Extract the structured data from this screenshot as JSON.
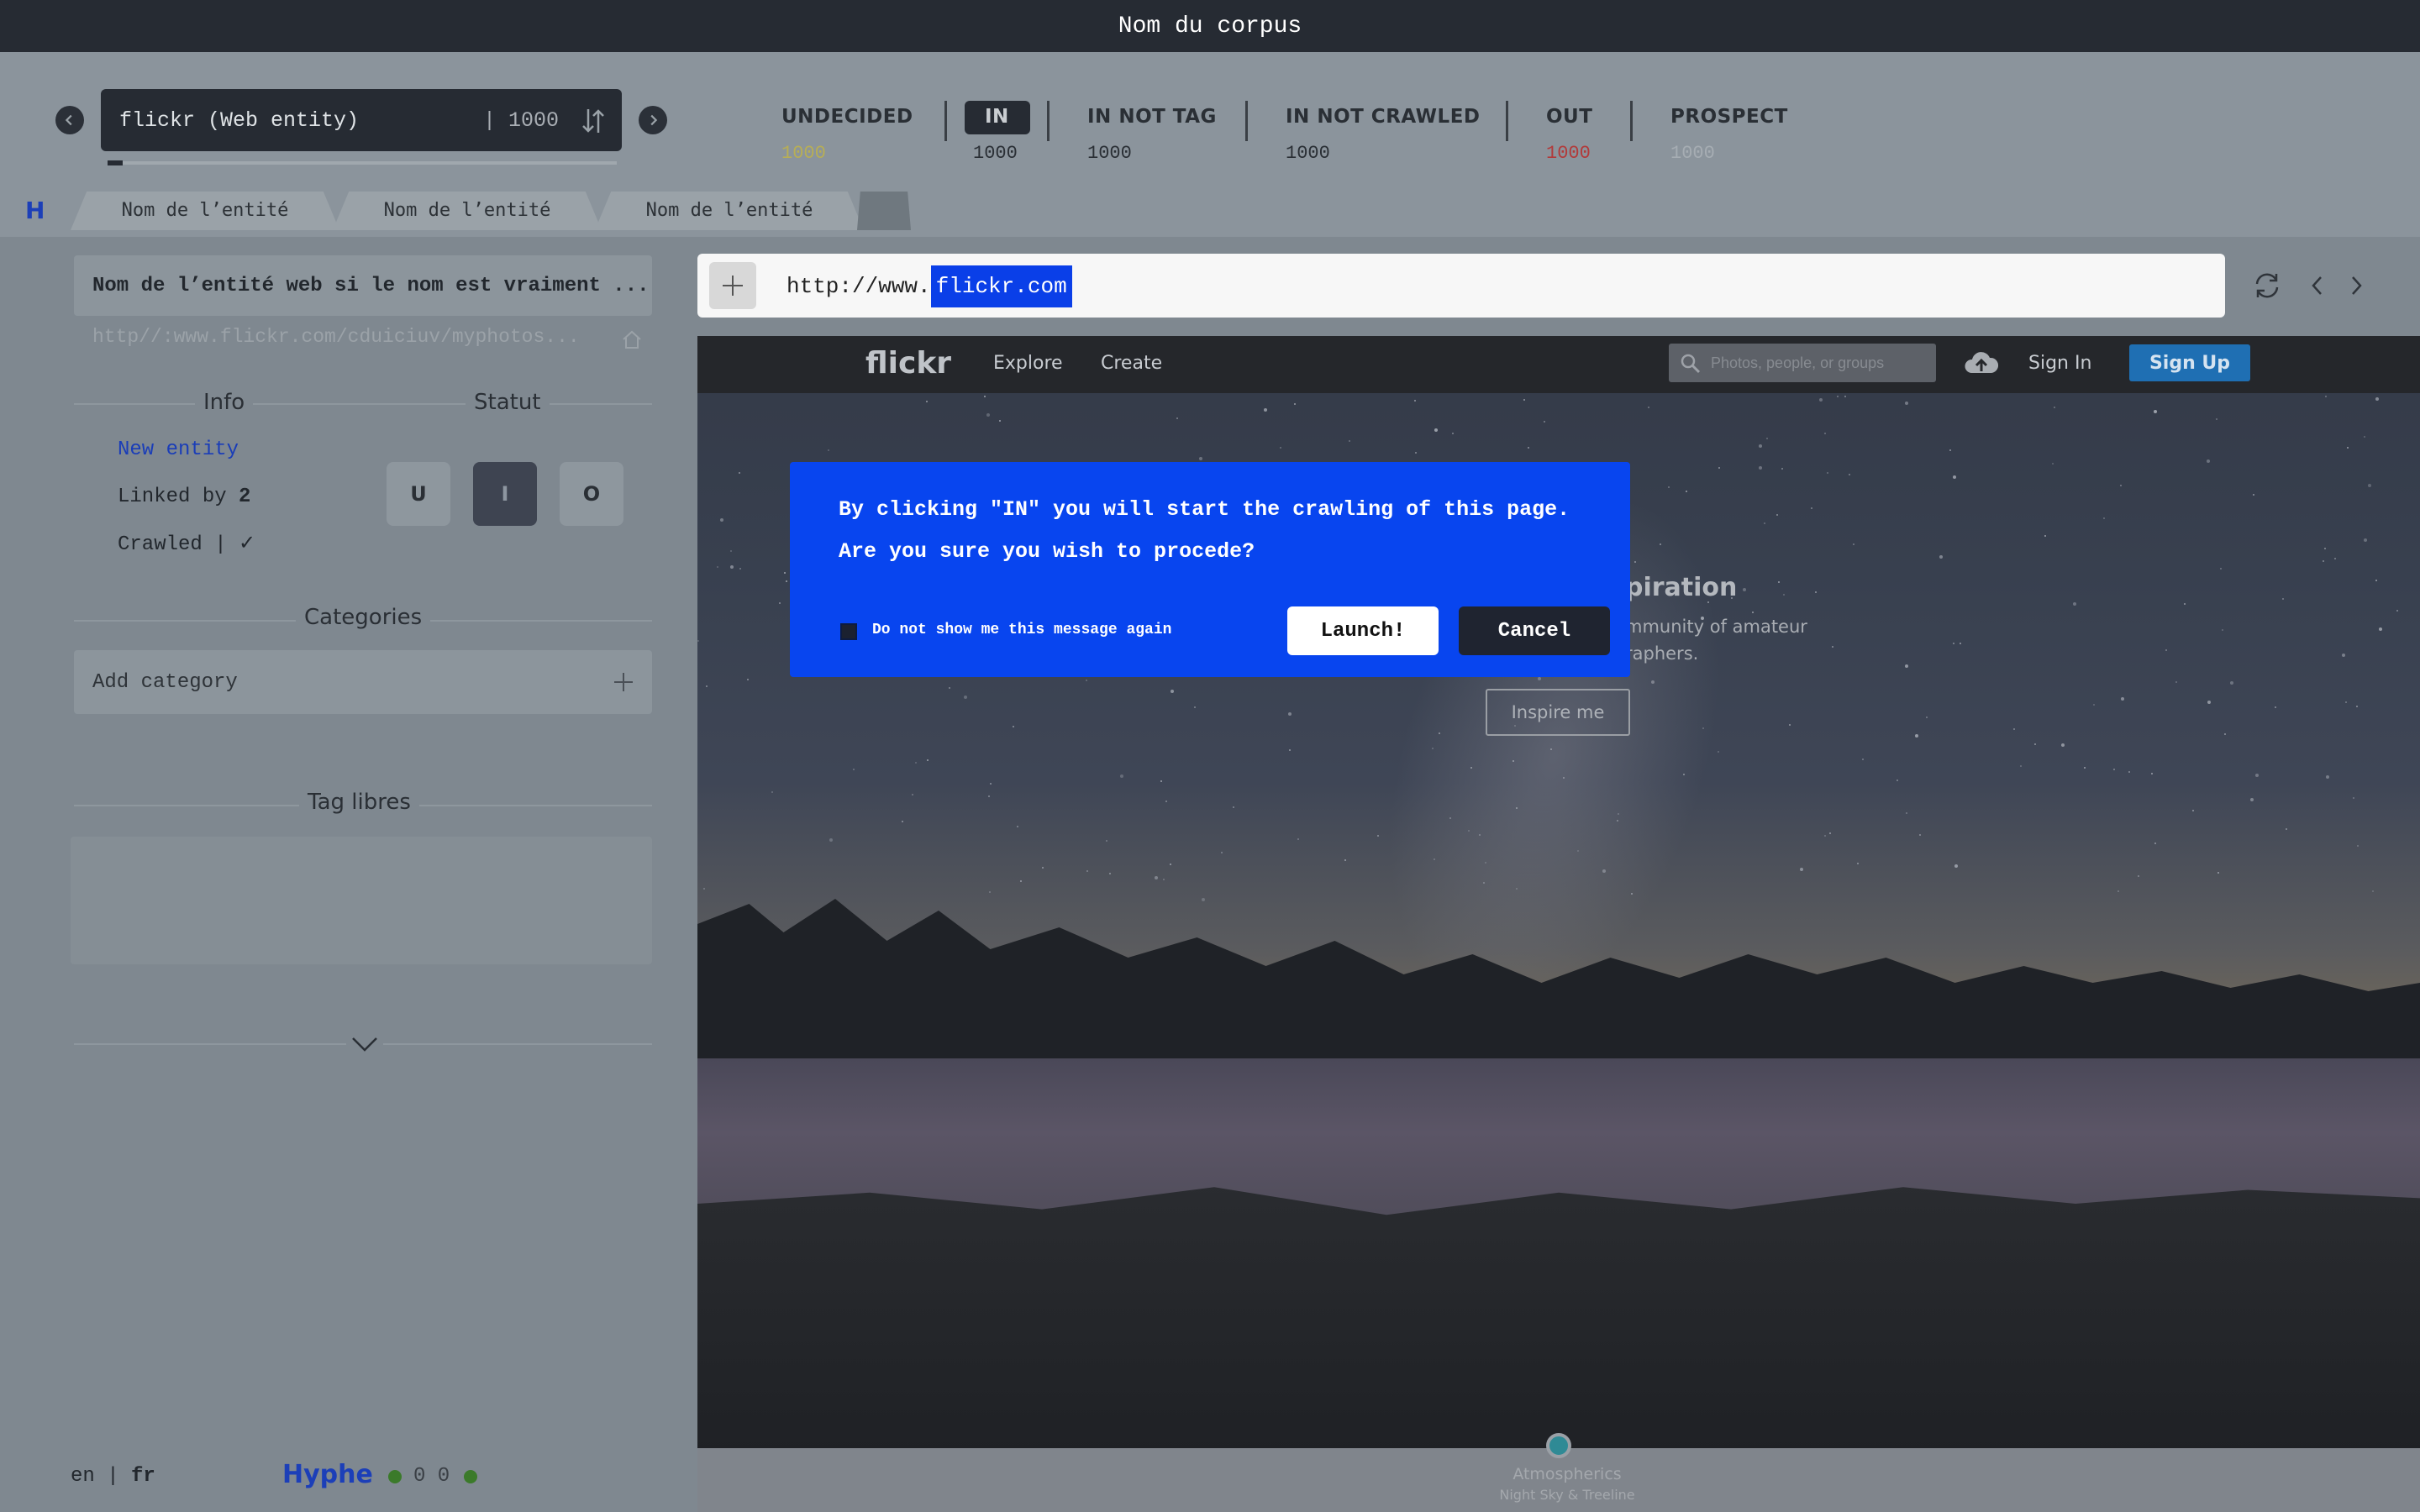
{
  "title": "Nom du corpus",
  "selector": {
    "entity": "flickr (Web entity)",
    "count": "| 1000",
    "progress": 0.03
  },
  "status_tabs": [
    {
      "label": "UNDECIDED",
      "count": "1000",
      "color": "#b7ae56"
    },
    {
      "label": "IN",
      "count": "1000",
      "color": "#2a2f35",
      "active": true
    },
    {
      "label": "IN NOT TAG",
      "count": "1000",
      "color": "#2a2f35"
    },
    {
      "label": "IN NOT CRAWLED",
      "count": "1000",
      "color": "#2a2f35"
    },
    {
      "label": "OUT",
      "count": "1000",
      "color": "#b23a3a"
    },
    {
      "label": "PROSPECT",
      "count": "1000",
      "color": "#a6adb3"
    }
  ],
  "entity_tabs": {
    "home": "H",
    "tabs": [
      "Nom de l’entité",
      "Nom de l’entité",
      "Nom de l’entité"
    ]
  },
  "sidebar": {
    "entity_name": "Nom de l’entité web si le nom est vraiment ...",
    "entity_url": "http//:www.flickr.com/cduiciuv/myphotos...",
    "info_title": "Info",
    "status_title": "Statut",
    "new_entity": "New entity",
    "linked_by_label": "Linked by",
    "linked_by_count": "2",
    "crawled_label": "Crawled |",
    "crawled_mark": "✓",
    "status_buttons": [
      "U",
      "I",
      "O"
    ],
    "categories_title": "Categories",
    "add_category_placeholder": "Add category",
    "tags_title": "Tag libres",
    "lang_en": "en",
    "lang_sep": "|",
    "lang_fr": "fr",
    "brand": "Hyphe",
    "footer_counts": "0 0"
  },
  "urlbar": {
    "prefix": "http://www.",
    "highlight": "flickr.com"
  },
  "flickr": {
    "logo": "flickr",
    "nav": [
      "Explore",
      "Create"
    ],
    "search_placeholder": "Photos, people, or groups",
    "sign_in": "Sign In",
    "sign_up": "Sign Up",
    "hero_title": "piration",
    "hero_sub1": "mmunity of amateur",
    "hero_sub2": "raphers.",
    "inspire": "Inspire me",
    "photo_title": "Atmospherics",
    "photo_sub": "Night Sky & Treeline"
  },
  "modal": {
    "line1": "By clicking \"IN\" you will start the crawling of this page.",
    "line2": "Are you sure you wish to procede?",
    "checkbox_label": "Do not show me this message again",
    "launch": "Launch!",
    "cancel": "Cancel"
  }
}
